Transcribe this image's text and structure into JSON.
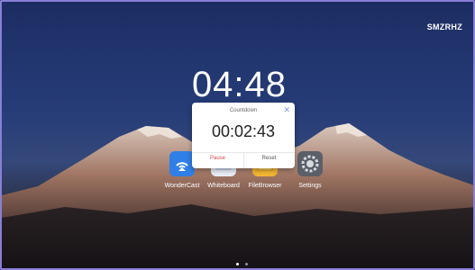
{
  "brand": "SMZRHZ",
  "clock": "04:48",
  "apps": [
    {
      "label": "WonderCast",
      "icon": "wondercast-icon",
      "color": "#2f7fe6"
    },
    {
      "label": "Whiteboard",
      "icon": "whiteboard-icon",
      "color": "#e8eef7"
    },
    {
      "label": "FileBrowser",
      "icon": "filebrowser-icon",
      "color": "#f2b632"
    },
    {
      "label": "Settings",
      "icon": "settings-icon",
      "color": "#5b5f68"
    }
  ],
  "countdown": {
    "title": "Countdown",
    "time": "00:02:43",
    "pause_label": "Pause",
    "reset_label": "Reset"
  },
  "page_indicator": {
    "count": 2,
    "active": 0
  },
  "colors": {
    "pause": "#d24a4a",
    "close": "#7a9cd8"
  }
}
